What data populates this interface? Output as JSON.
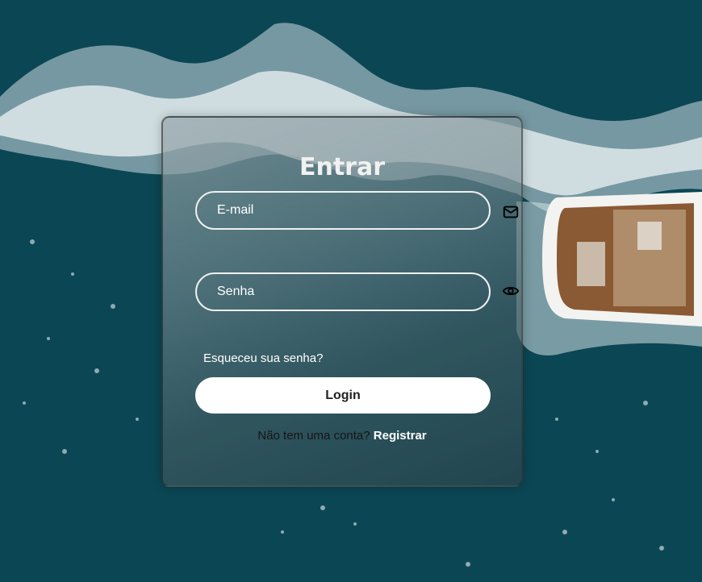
{
  "background": {
    "water_color": "#0d4a58",
    "foam_color": "#e8eef0",
    "boat_deck_color": "#8a5a34"
  },
  "login_card": {
    "title": "Entrar",
    "email": {
      "placeholder": "E-mail",
      "value": "",
      "icon": "mail-icon"
    },
    "password": {
      "placeholder": "Senha",
      "value": "",
      "icon": "eye-icon"
    },
    "forgot_password": "Esqueceu sua senha?",
    "login_button": "Login",
    "register_prompt": "Não tem uma conta?",
    "register_link": "Registrar"
  }
}
